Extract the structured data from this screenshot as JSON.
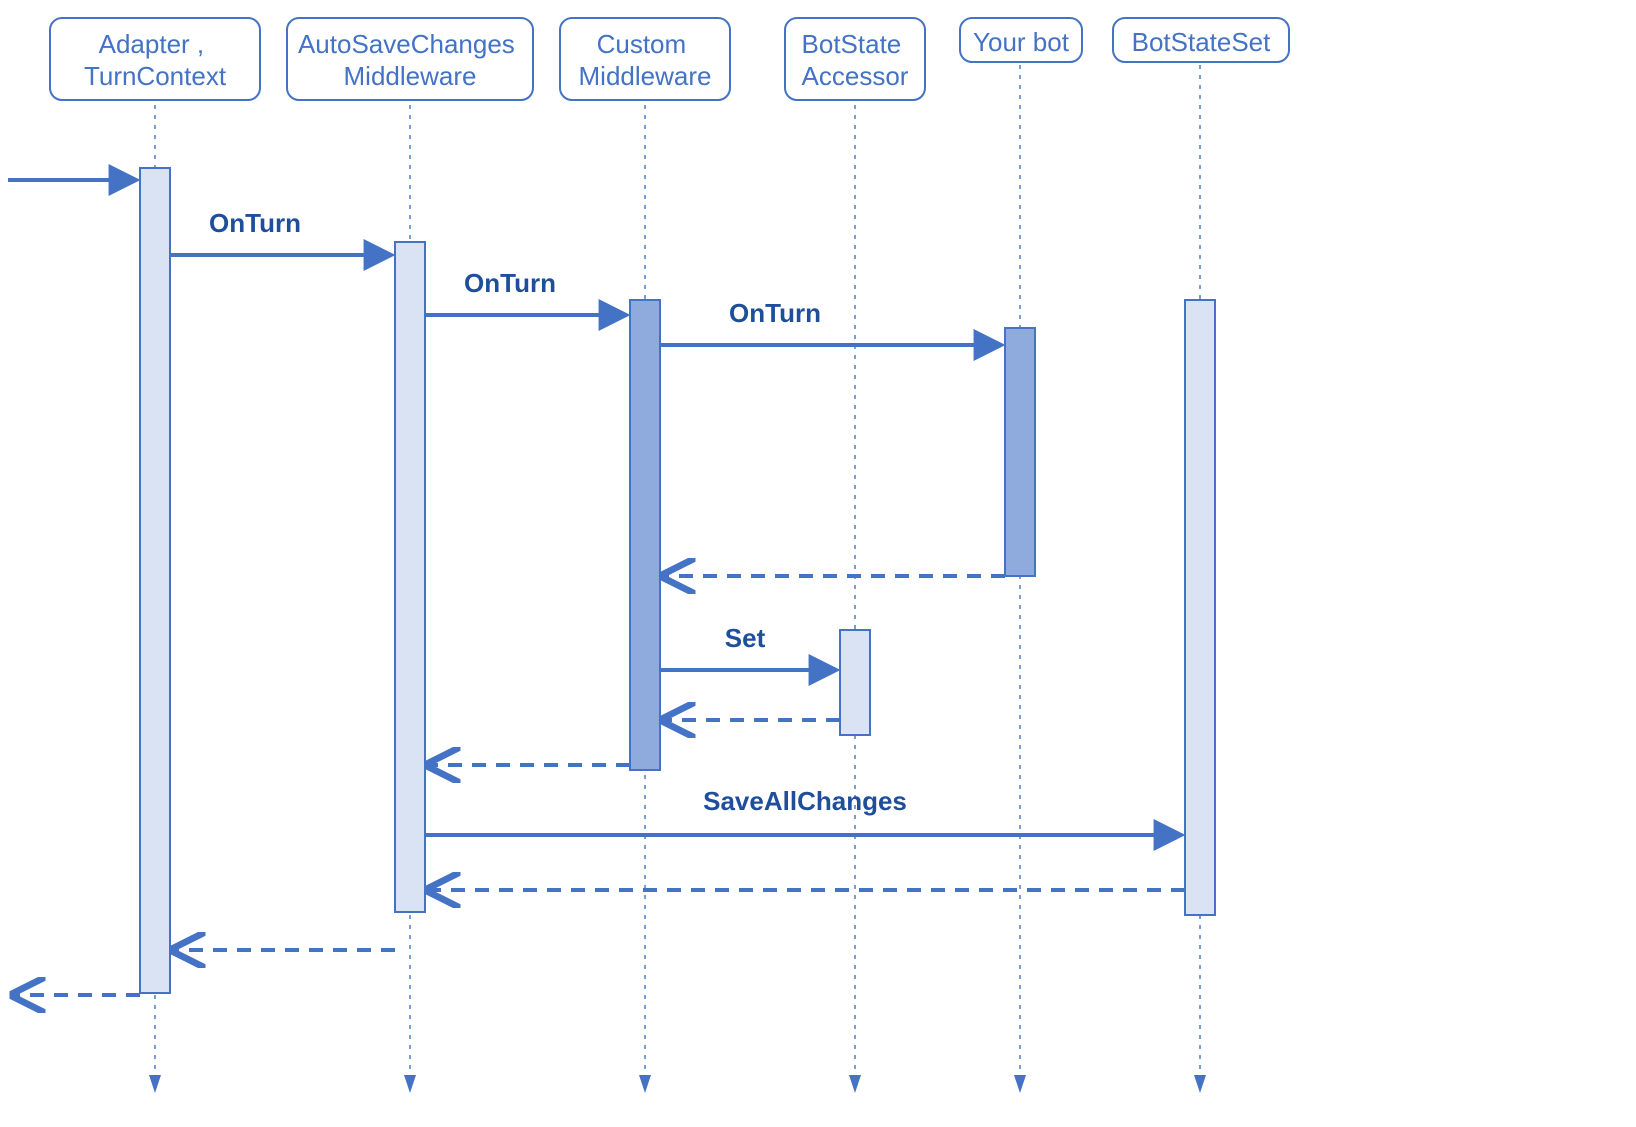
{
  "participants": {
    "p1": {
      "lines": [
        "Adapter ,",
        "TurnContext"
      ]
    },
    "p2": {
      "lines": [
        "AutoSaveChanges",
        "Middleware"
      ]
    },
    "p3": {
      "lines": [
        "Custom",
        "Middleware"
      ]
    },
    "p4": {
      "lines": [
        "BotState",
        "Accessor"
      ]
    },
    "p5": {
      "lines": [
        "Your bot"
      ]
    },
    "p6": {
      "lines": [
        "BotStateSet"
      ]
    }
  },
  "messages": {
    "m_onturn_1": "OnTurn",
    "m_onturn_2": "OnTurn",
    "m_onturn_3": "OnTurn",
    "m_set": "Set",
    "m_saveall": "SaveAllChanges"
  }
}
